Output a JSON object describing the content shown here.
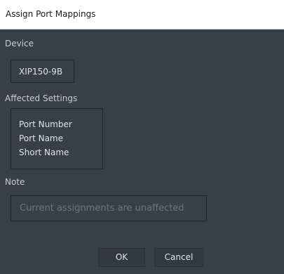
{
  "window": {
    "title": "Assign Port Mappings"
  },
  "device": {
    "label": "Device",
    "value": "XIP150-9B"
  },
  "affected_settings": {
    "label": "Affected Settings",
    "items": [
      "Port Number",
      "Port Name",
      "Short Name"
    ]
  },
  "note": {
    "label": "Note",
    "placeholder": "Current assignments are unaffected"
  },
  "buttons": {
    "ok_label": "OK",
    "cancel_label": "Cancel"
  },
  "colors": {
    "dialog_background": "#3a3f46",
    "titlebar_background": "#ffffff",
    "text": "#dfe2e6",
    "placeholder_text": "#6e747c"
  }
}
